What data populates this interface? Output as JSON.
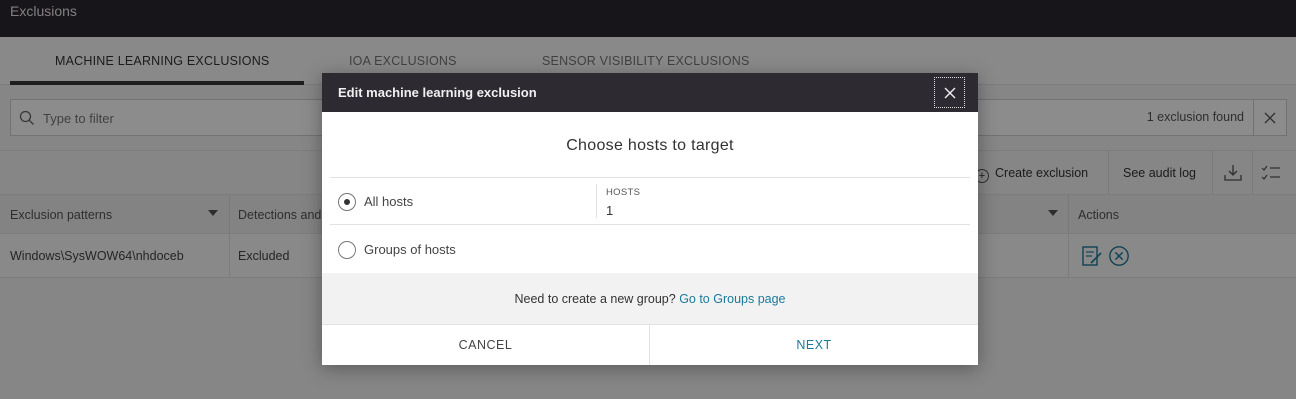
{
  "page": {
    "title": "Exclusions",
    "tabs": [
      {
        "label": "MACHINE LEARNING EXCLUSIONS"
      },
      {
        "label": "IOA EXCLUSIONS"
      },
      {
        "label": "SENSOR VISIBILITY EXCLUSIONS"
      }
    ],
    "filter": {
      "placeholder": "Type to filter",
      "count": "1 exclusion found"
    },
    "toolbar": {
      "create_label": "Create exclusion",
      "audit_label": "See audit log"
    },
    "table": {
      "columns": [
        "Exclusion patterns",
        "Detections and",
        "Actions"
      ],
      "rows": [
        {
          "pattern": "Windows\\SysWOW64\\nhdoceb",
          "detections": "Excluded"
        }
      ]
    }
  },
  "modal": {
    "title": "Edit machine learning exclusion",
    "heading": "Choose hosts to target",
    "options": [
      {
        "label": "All hosts",
        "checked": true
      },
      {
        "label": "Groups of hosts",
        "checked": false
      }
    ],
    "hosts_label": "HOSTS",
    "hosts_value": "1",
    "info_text": "Need to create a new group?",
    "info_link": "Go to Groups page",
    "cancel_label": "CANCEL",
    "next_label": "NEXT"
  },
  "colors": {
    "accent": "#1a7a9a",
    "header_bg": "#2e2a31",
    "topbar_bg": "#2b2730"
  }
}
